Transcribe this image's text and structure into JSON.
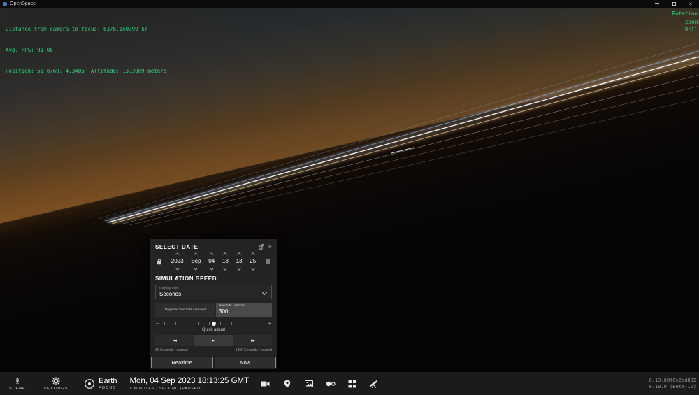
{
  "window": {
    "title": "OpenSpace"
  },
  "hud": {
    "lines": [
      "Distance from camera to focus: 6378.150399 km",
      "Avg. FPS: 91.08",
      "Position: 51.8769, 4.3486  Altitude: 13.3989 meters"
    ],
    "axis_labels": [
      "Rotation",
      "Zoom",
      "Roll"
    ],
    "text_color": "#35d17e"
  },
  "date_popup": {
    "title": "SELECT DATE",
    "fields": [
      "2023",
      "Sep",
      "04",
      "18",
      "13",
      "25"
    ],
    "simulation_speed_title": "SIMULATION SPEED",
    "display_unit_label": "Display unit",
    "display_unit_value": "Seconds",
    "negative_button_label": "Negative Seconds / second",
    "speed_input_label": "Seconds / second",
    "speed_input_value": "300",
    "quick_adjust_label": "Quick adjust",
    "min_speed_label": "60 Seconds / second",
    "max_speed_label": "1800 Seconds / second",
    "realtime_button": "Realtime",
    "now_button": "Now"
  },
  "taskbar": {
    "scene_label": "SCENE",
    "settings_label": "SETTINGS",
    "focus_name": "Earth",
    "focus_label": "FOCUS",
    "datetime": "Mon, 04 Sep 2023 18:13:25 GMT",
    "speed_status": "5 MINUTES / SECOND (PAUSED)"
  },
  "version": {
    "build": "0.19.0@f6e2cd882",
    "release": "0.19.0 (Beta-12)"
  },
  "icons": {
    "close": "×",
    "rewind": "◂◂",
    "play": "▸",
    "fast_forward": "▸▸",
    "minus": "−",
    "plus": "+"
  }
}
